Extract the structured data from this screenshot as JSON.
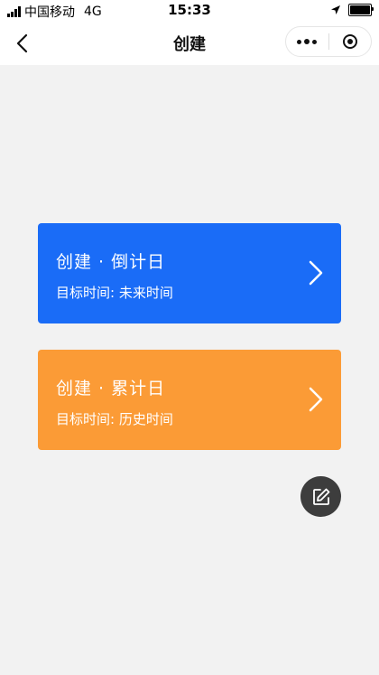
{
  "status_bar": {
    "carrier": "中国移动",
    "network": "4G",
    "time": "15:33"
  },
  "nav": {
    "title": "创建",
    "back_icon": "chevron-left-icon",
    "more_icon": "more-dots-icon",
    "close_icon": "target-icon"
  },
  "cards": [
    {
      "title": "创建 · 倒计日",
      "subtitle": "目标时间: 未来时间",
      "color": "#1a6cf7"
    },
    {
      "title": "创建 · 累计日",
      "subtitle": "目标时间: 历史时间",
      "color": "#fb9b36"
    }
  ],
  "fab": {
    "icon": "edit-icon",
    "color": "#3d3d3d"
  },
  "colors": {
    "background": "#f2f2f2",
    "nav_background": "#ffffff"
  }
}
